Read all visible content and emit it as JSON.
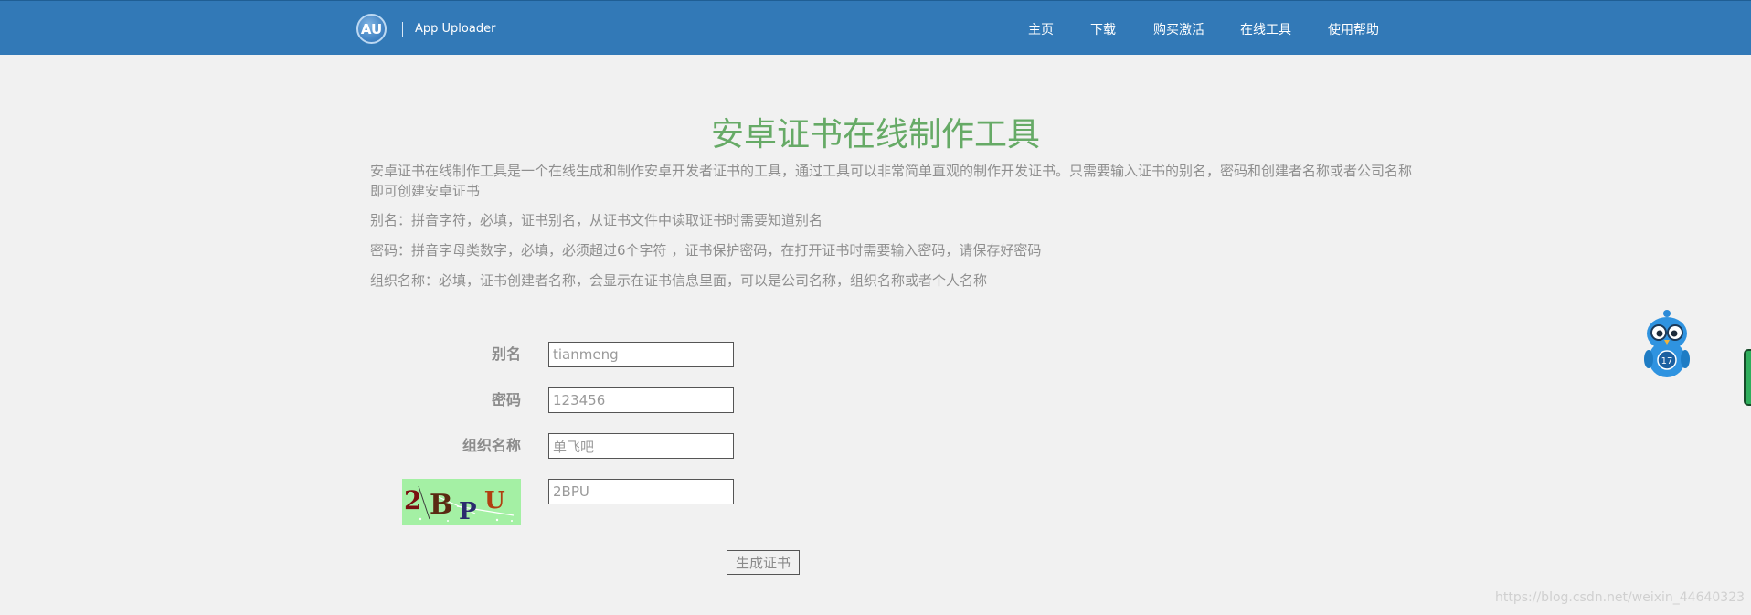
{
  "header": {
    "logo_text": "AU",
    "brand": "App Uploader",
    "nav": [
      "主页",
      "下载",
      "购买激活",
      "在线工具",
      "使用帮助"
    ],
    "bar_color": "#3279b7"
  },
  "main": {
    "title": "安卓证书在线制作工具",
    "intro": "安卓证书在线制作工具是一个在线生成和制作安卓开发者证书的工具，通过工具可以非常简单直观的制作开发证书。只需要输入证书的别名，密码和创建者名称或者公司名称即可创建安卓证书",
    "note_alias": "别名：拼音字符，必填，证书别名，从证书文件中读取证书时需要知道别名",
    "note_password": "密码：拼音字母类数字，必填，必须超过6个字符 ，证书保护密码，在打开证书时需要输入密码，请保存好密码",
    "note_org": "组织名称：必填，证书创建者名称，会显示在证书信息里面，可以是公司名称，组织名称或者个人名称",
    "title_color": "#66aa66"
  },
  "form": {
    "alias_label": "别名",
    "alias_value": "tianmeng",
    "password_label": "密码",
    "password_value": "123456",
    "org_label": "组织名称",
    "org_value": "单飞吧",
    "captcha_value": "2BPU",
    "submit_label": "生成证书"
  },
  "widget": {
    "mascot_badge": "17",
    "mascot_icon": "owl-mascot-icon"
  },
  "watermark": "https://blog.csdn.net/weixin_44640323"
}
